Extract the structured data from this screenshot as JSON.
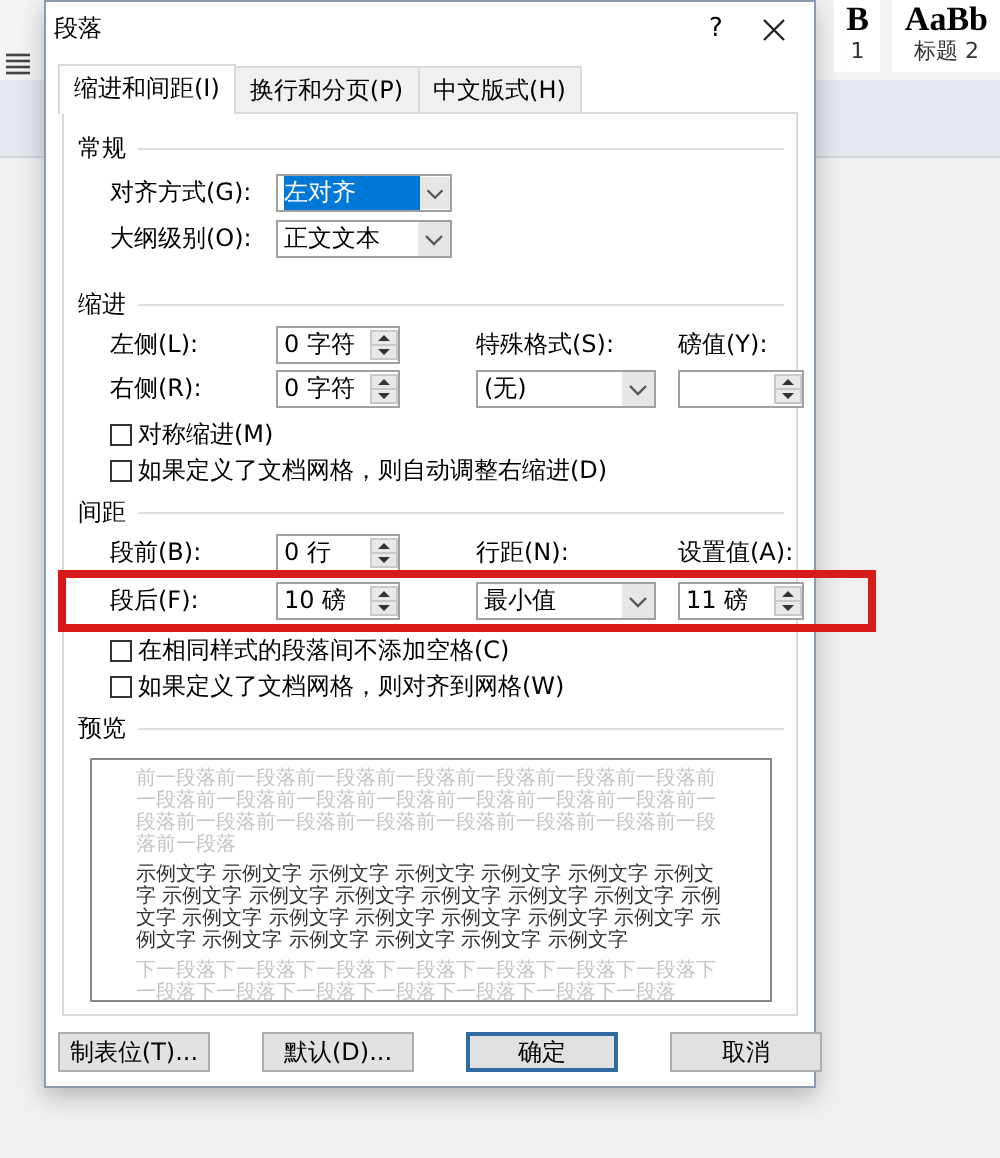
{
  "backdrop": {
    "style_gallery": [
      {
        "preview": "B",
        "name": "1"
      },
      {
        "preview": "AaBb",
        "name": "标题 2"
      }
    ]
  },
  "dialog": {
    "title": "段落",
    "help": "?"
  },
  "tabs": [
    {
      "label": "缩进和间距(I)",
      "selected": true
    },
    {
      "label": "换行和分页(P)",
      "selected": false
    },
    {
      "label": "中文版式(H)",
      "selected": false
    }
  ],
  "general": {
    "heading": "常规",
    "fields": [
      {
        "label": "对齐方式(G):",
        "value": "左对齐",
        "highlighted": true
      },
      {
        "label": "大纲级别(O):",
        "value": "正文文本",
        "highlighted": false
      }
    ]
  },
  "indent": {
    "heading": "缩进",
    "rows": [
      {
        "highlighted": false,
        "cells": [
          {
            "kind": "label",
            "text": "左侧(L):"
          },
          {
            "kind": "spinner",
            "value": "0 字符"
          },
          {
            "kind": "label",
            "text": "特殊格式(S):"
          },
          {
            "kind": "label",
            "text": "磅值(Y):"
          }
        ]
      },
      {
        "highlighted": false,
        "cells": [
          {
            "kind": "label",
            "text": "右侧(R):"
          },
          {
            "kind": "spinner",
            "value": "0 字符"
          },
          {
            "kind": "dropdown",
            "value": "(无)"
          },
          {
            "kind": "spinner"
          }
        ]
      }
    ],
    "checkboxes": [
      {
        "label": "对称缩进(M)",
        "checked": false
      },
      {
        "label": "如果定义了文档网格，则自动调整右缩进(D)",
        "checked": false
      }
    ]
  },
  "spacing": {
    "heading": "间距",
    "rows": [
      {
        "highlighted": false,
        "cells": [
          {
            "kind": "label",
            "text": "段前(B):"
          },
          {
            "kind": "spinner",
            "value": "0 行"
          },
          {
            "kind": "label",
            "text": "行距(N):"
          },
          {
            "kind": "label",
            "text": "设置值(A):"
          }
        ]
      },
      {
        "highlighted": true,
        "cells": [
          {
            "kind": "label",
            "text": "段后(F):"
          },
          {
            "kind": "spinner",
            "value": "10 磅"
          },
          {
            "kind": "dropdown",
            "value": "最小值"
          },
          {
            "kind": "spinner",
            "value": "11 磅"
          }
        ]
      }
    ],
    "checkboxes": [
      {
        "label": "在相同样式的段落间不添加空格(C)",
        "checked": false
      },
      {
        "label": "如果定义了文档网格，则对齐到网格(W)",
        "checked": false
      }
    ]
  },
  "preview": {
    "heading": "预览",
    "paragraphs": [
      {
        "kind": "previous",
        "text": "前一段落前一段落前一段落前一段落前一段落前一段落前一段落前一段落前一段落前一段落前一段落前一段落前一段落前一段落前一段落前一段落前一段落前一段落前一段落前一段落前一段落前一段落前一段落"
      },
      {
        "kind": "sample",
        "text": "示例文字 示例文字 示例文字 示例文字 示例文字 示例文字 示例文字 示例文字 示例文字 示例文字 示例文字 示例文字 示例文字 示例文字 示例文字 示例文字 示例文字 示例文字 示例文字 示例文字 示例文字 示例文字 示例文字 示例文字 示例文字 示例文字"
      },
      {
        "kind": "next",
        "text": "下一段落下一段落下一段落下一段落下一段落下一段落下一段落下一段落下一段落下一段落下一段落下一段落下一段落下一段落"
      }
    ]
  },
  "buttons": [
    {
      "label": "制表位(T)...",
      "default": false
    },
    {
      "label": "默认(D)...",
      "default": false
    },
    {
      "label": "确定",
      "default": true
    },
    {
      "label": "取消",
      "default": false
    }
  ]
}
